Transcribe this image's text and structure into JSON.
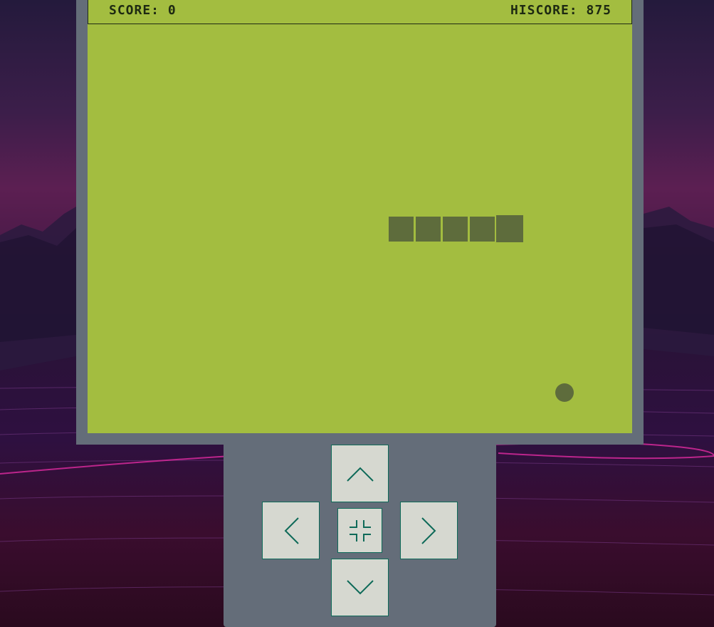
{
  "game": {
    "score_text": "SCORE: 0",
    "hiscore_text": "HISCORE: 875",
    "score": 0,
    "hiscore": 875
  },
  "controls": {
    "up": "arrow-up-icon",
    "down": "arrow-down-icon",
    "left": "arrow-left-icon",
    "right": "arrow-right-icon",
    "center": "fullscreen-exit-icon"
  },
  "colors": {
    "screen": "#a3bd40",
    "snake": "#5e6c3c",
    "device": "#646d79",
    "button": "#d6d8d0",
    "button_border": "#0e6a58"
  }
}
